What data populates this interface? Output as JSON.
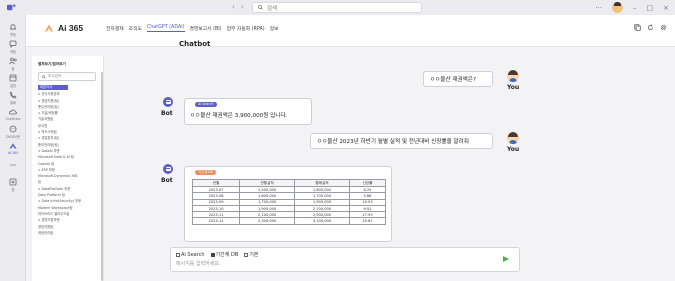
{
  "titlebar": {
    "back": "‹",
    "forward": "›",
    "search_placeholder": "검색",
    "window_controls": [
      "···",
      "–",
      "□",
      "×"
    ]
  },
  "rail": {
    "items": [
      {
        "label": "활동",
        "icon": "bell-icon"
      },
      {
        "label": "채팅",
        "icon": "chat-icon"
      },
      {
        "label": "팀",
        "icon": "teams-icon"
      },
      {
        "label": "일정",
        "icon": "calendar-icon"
      },
      {
        "label": "통화",
        "icon": "phone-icon"
      },
      {
        "label": "OneDrive",
        "icon": "cloud-icon"
      },
      {
        "label": "DYDEV봇",
        "icon": "bot-icon"
      },
      {
        "label": "AI 365",
        "icon": "app-icon",
        "active": true
      },
      {
        "label": "",
        "icon": "more-icon"
      },
      {
        "label": "앱",
        "icon": "apps-icon"
      }
    ]
  },
  "app": {
    "name": "Ai 365",
    "menu": [
      "전자결재",
      "조직도",
      "ChatGPT (ADAI)",
      "경영보고서 (BI)",
      "업무 자동화 (RPA)",
      "정보"
    ],
    "active_menu": "ChatGPT (ADAI)",
    "page_title": "Chatbot",
    "head_icons": [
      "copy-icon",
      "refresh-icon",
      "settings-icon"
    ]
  },
  "tree": {
    "title": "펼쳐보기/접어보기",
    "search_placeholder": "부서검색",
    "nodes": [
      {
        "label": "대표이사",
        "selected": true
      },
      {
        "label": "∨ 전사지원본부"
      },
      {
        "label": "  ∨ 경영지원(팀)"
      },
      {
        "label": "     총무관리팀(팀)"
      },
      {
        "label": "  ∨ 지급/비정률"
      },
      {
        "label": "     기술지원팀"
      },
      {
        "label": "  부서명"
      },
      {
        "label": "∨ 하드스탠팀"
      },
      {
        "label": "  ∨ 영업본부(팀)"
      },
      {
        "label": "     총무관리팀(팀)"
      },
      {
        "label": "∨ DataAI 부문"
      },
      {
        "label": "     Microsoft Data & AI 팀"
      },
      {
        "label": "     OpenAI 팀"
      },
      {
        "label": "∨ ERP 부문"
      },
      {
        "label": "     Microsoft Dynamics 365"
      },
      {
        "label": "     팀"
      },
      {
        "label": "∨ DataPlatform 부문"
      },
      {
        "label": "     Data Platform 팀"
      },
      {
        "label": "∨ Data Infra(Security) 부문"
      },
      {
        "label": "     Modern Workspace팀"
      },
      {
        "label": "     하이브리드 클라우드팀"
      },
      {
        "label": "∨ 경영지원부문"
      },
      {
        "label": "     경영지원팀"
      },
      {
        "label": "     재정관리팀"
      }
    ]
  },
  "chat": {
    "user_label": "You",
    "bot_label": "Bot",
    "messages": [
      {
        "role": "user",
        "text": "ㅇㅇ물산 재권액은?"
      },
      {
        "role": "bot",
        "tag": "AI Search",
        "text": "ㅇㅇ물산 재권액은 3,900,000원 입니다."
      },
      {
        "role": "user",
        "text": "ㅇㅇ물산 2023년 하반기 월별 실적 및 전년대비 신장률을 알려줘"
      },
      {
        "role": "bot",
        "tag": "기간계 DB"
      }
    ],
    "table": {
      "headers": [
        "년월",
        "전월실적",
        "월매실적",
        "신장률"
      ],
      "rows": [
        [
          "2023-07",
          "1,500,000",
          "1,600,000",
          "6.25"
        ],
        [
          "2023-08",
          "1,600,000",
          "1,700,000",
          "5.88"
        ],
        [
          "2023-09",
          "1,700,000",
          "1,900,000",
          "10.53"
        ],
        [
          "2023-10",
          "1,900,000",
          "2,100,000",
          "9.52"
        ],
        [
          "2023-11",
          "2,100,000",
          "2,900,000",
          "27.59"
        ],
        [
          "2023-12",
          "2,300,000",
          "3,100,000",
          "25.81"
        ]
      ]
    }
  },
  "composer": {
    "options": [
      {
        "label": "Ai Search",
        "checked": false
      },
      {
        "label": "기간계 DB",
        "checked": true
      },
      {
        "label": "기본",
        "checked": false
      }
    ],
    "placeholder": "메시지를 입력하세요."
  },
  "colors": {
    "accent": "#5b5fc7",
    "tag_orange": "#f08c5a",
    "send": "#4cae4c"
  }
}
